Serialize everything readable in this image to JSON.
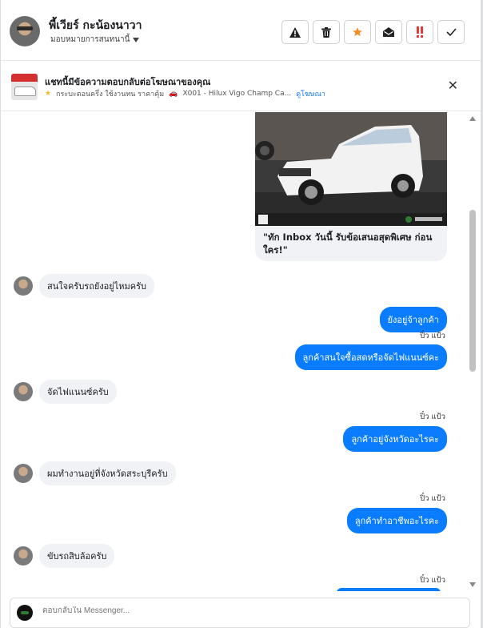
{
  "header": {
    "name": "พี้เวียร์ กะน้องนาวา",
    "assign_label": "มอบหมายการสนทนานี้",
    "actions": [
      {
        "icon": "warning-icon",
        "glyph": "▲"
      },
      {
        "icon": "trash-icon",
        "glyph": "🗑"
      },
      {
        "icon": "star-icon",
        "glyph": "★"
      },
      {
        "icon": "mark-unread-icon",
        "glyph": "✉"
      },
      {
        "icon": "priority-icon",
        "glyph": "‼"
      },
      {
        "icon": "check-icon",
        "glyph": "✓"
      }
    ]
  },
  "ad_banner": {
    "title": "แชทนี้มีข้อความตอบกลับต่อโฆษณาของคุณ",
    "detail": "กระบะตอนครึ่ง ใช้งานทน ราคาคุ้ม",
    "product": "X001 - Hilux Vigo Champ Ca...",
    "link": "ดูโฆษณา"
  },
  "conversation": {
    "image_caption": "\"ทัก Inbox วันนี้ รับข้อเสนอสุดพิเศษ ก่อนใคร!\"",
    "messages": [
      {
        "side": "in",
        "text": "สนใจครับรถยังอยู่ไหมครับ"
      },
      {
        "side": "out",
        "text": "ยังอยู่จ้าลูกค้า"
      },
      {
        "side": "seen",
        "text": "ปิ๋ว แป้ว"
      },
      {
        "side": "out",
        "text": "ลูกค้าสนใจซื้อสดหรือจัดไฟแนนซ์คะ"
      },
      {
        "side": "in",
        "text": "จัดไฟแนนซ์ครับ"
      },
      {
        "side": "seen",
        "text": "ปิ๋ว แป้ว"
      },
      {
        "side": "out",
        "text": "ลูกค้าอยู่จังหวัดอะไรคะ"
      },
      {
        "side": "in",
        "text": "ผมทำงานอยู่ที่จังหวัดสระบุรีครับ"
      },
      {
        "side": "seen",
        "text": "ปิ๋ว แป้ว"
      },
      {
        "side": "out",
        "text": "ลูกค้าทำอาชีพอะไรคะ"
      },
      {
        "side": "in",
        "text": "ขับรถสิบล้อครับ"
      },
      {
        "side": "seen",
        "text": "ปิ๋ว แป้ว"
      }
    ]
  },
  "composer": {
    "placeholder": "ตอบกลับใน Messenger..."
  },
  "colors": {
    "outgoing_bubble": "#0a7cff",
    "incoming_bubble": "#f0f2f5",
    "link": "#1877f2"
  }
}
